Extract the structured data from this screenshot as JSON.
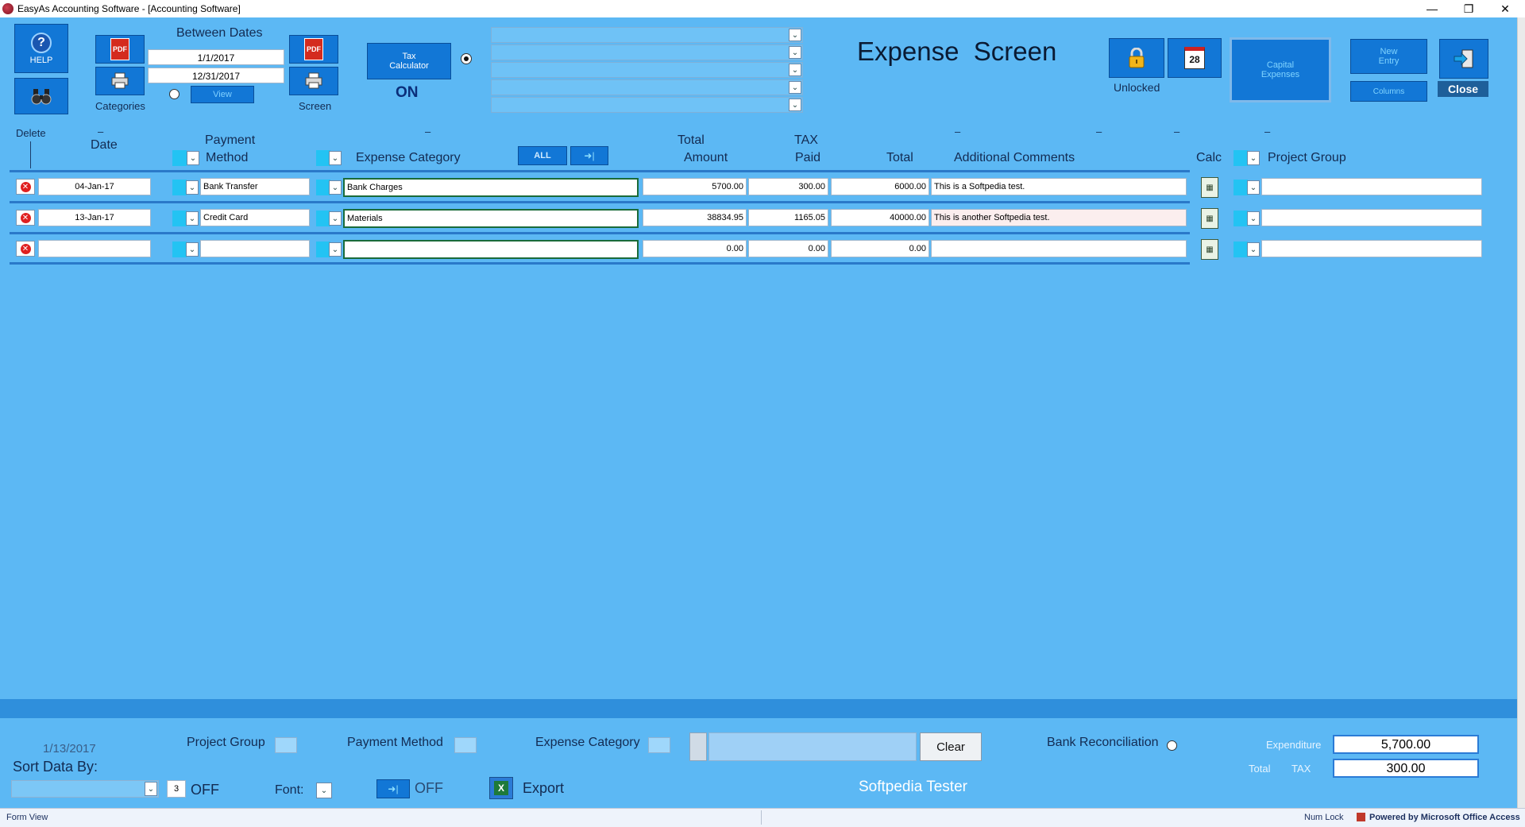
{
  "window": {
    "title": "EasyAs Accounting Software - [Accounting Software]",
    "controls": {
      "minimize": "—",
      "restore": "❐",
      "close": "✕"
    }
  },
  "toolbar": {
    "help_label": "HELP",
    "categories_label": "Categories",
    "between_dates_label": "Between Dates",
    "date_from": "1/1/2017",
    "date_to": "12/31/2017",
    "view_label": "View",
    "screen_label": "Screen",
    "tax_calculator_label": "Tax Calculator",
    "tax_state": "ON",
    "pdf_label": "PDF",
    "screen_title": "Expense  Screen",
    "lock_state": "Unlocked",
    "calendar_day": "28",
    "capital_expenses_label": "Capital Expenses",
    "new_entry_label": "New Entry",
    "columns_label": "Columns",
    "close_label": "Close",
    "all_label": "ALL"
  },
  "headers": {
    "delete": "Delete",
    "date": "Date",
    "payment_top": "Payment",
    "payment_bottom": "Method",
    "expense_category": "Expense Category",
    "total_amount_top": "Total",
    "total_amount_bottom": "Amount",
    "tax_top": "TAX",
    "tax_bottom": "Paid",
    "total": "Total",
    "comments": "Additional Comments",
    "calc": "Calc",
    "project_group": "Project Group",
    "dash": "–"
  },
  "rows": [
    {
      "date": "04-Jan-17",
      "method": "Bank Transfer",
      "category": "Bank Charges",
      "amount": "5700.00",
      "tax": "300.00",
      "total": "6000.00",
      "comment": "This is a Softpedia test.",
      "project": ""
    },
    {
      "date": "13-Jan-17",
      "method": "Credit Card",
      "category": "Materials",
      "amount": "38834.95",
      "tax": "1165.05",
      "total": "40000.00",
      "comment": "This is another Softpedia test.",
      "project": ""
    },
    {
      "date": "",
      "method": "",
      "category": "",
      "amount": "0.00",
      "tax": "0.00",
      "total": "0.00",
      "comment": "",
      "project": ""
    }
  ],
  "footer": {
    "current_date": "1/13/2017",
    "sort_label": "Sort Data By:",
    "sort_number": "3",
    "sort_state": "OFF",
    "font_label": "Font:",
    "toggle_state": "OFF",
    "export_label": "Export",
    "project_group_label": "Project Group",
    "payment_method_label": "Payment Method",
    "expense_category_label": "Expense Category",
    "clear_label": "Clear",
    "bank_reconciliation_label": "Bank Reconciliation",
    "user_name": "Softpedia Tester",
    "expenditure_label": "Expenditure",
    "expenditure_value": "5,700.00",
    "total_label": "Total",
    "tax_label": "TAX",
    "tax_total_value": "300.00"
  },
  "statusbar": {
    "mode": "Form View",
    "num_lock": "Num Lock",
    "powered_by": "Powered by Microsoft Office Access"
  },
  "colors": {
    "form_background": "#5cb8f4",
    "tile_blue": "#1277d6",
    "cyan_selector": "#23c3f3",
    "delete_red": "#e02020"
  },
  "icons": [
    "help-icon",
    "binoculars-icon",
    "pdf-icon",
    "printer-icon",
    "lock-icon",
    "calendar-icon",
    "exit-icon",
    "arrow-right-icon",
    "delete-icon",
    "calculator-icon",
    "excel-icon",
    "chevron-down-icon"
  ]
}
